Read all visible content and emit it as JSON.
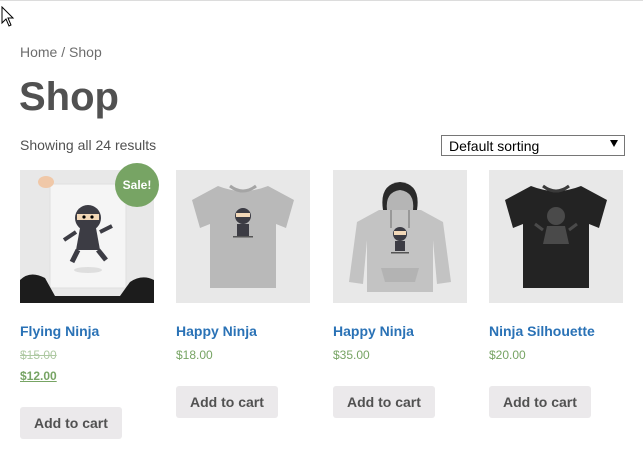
{
  "breadcrumb": {
    "home": "Home",
    "separator": " / ",
    "current": "Shop"
  },
  "page": {
    "title": "Shop",
    "result_count": "Showing all 24 results"
  },
  "sorting": {
    "selected": "Default sorting"
  },
  "colors": {
    "link": "#2a72b6",
    "price": "#77a464",
    "sale_badge": "#77a464",
    "button_bg": "#ebe9eb",
    "text": "#515151"
  },
  "products": [
    {
      "name": "Flying Ninja",
      "regular_price": "$15.00",
      "sale_price": "$12.00",
      "badge": "Sale!",
      "button": "Add to cart",
      "image_icon": "poster-ninja-icon"
    },
    {
      "name": "Happy Ninja",
      "price": "$18.00",
      "button": "Add to cart",
      "image_icon": "grey-tshirt-icon"
    },
    {
      "name": "Happy Ninja",
      "price": "$35.00",
      "button": "Add to cart",
      "image_icon": "grey-hoodie-icon"
    },
    {
      "name": "Ninja Silhouette",
      "price": "$20.00",
      "button": "Add to cart",
      "image_icon": "black-tshirt-icon"
    }
  ]
}
